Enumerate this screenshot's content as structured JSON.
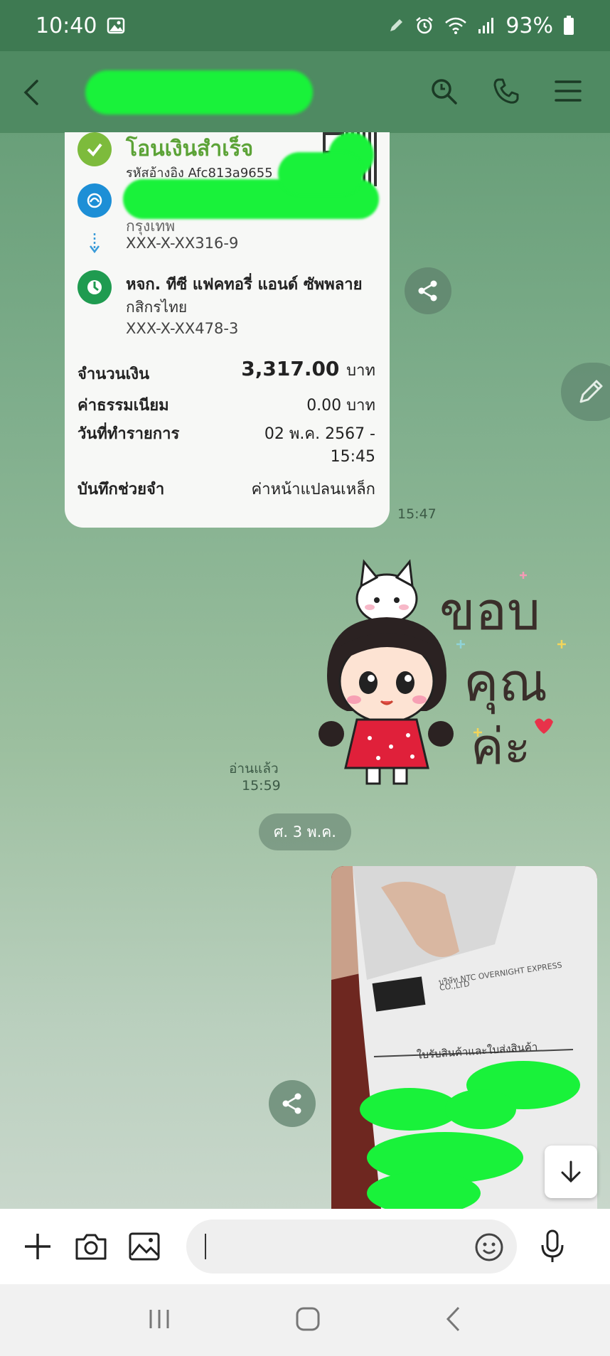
{
  "status_bar": {
    "time": "10:40",
    "battery": "93%",
    "icons": [
      "gallery-icon",
      "pen-icon",
      "alarm-icon",
      "wifi-icon",
      "signal-icon",
      "battery-icon"
    ]
  },
  "header": {
    "icons": [
      "back-icon",
      "search-icon",
      "phone-icon",
      "menu-icon"
    ]
  },
  "receipt": {
    "title": "โอนเงินสำเร็จ",
    "reference": "รหัสอ้างอิง Afc813a9655",
    "sender_account": "XXX-X-XX316-9",
    "sender_bank_partial": "กรุงเทพ",
    "recipient_name": "หจก. ทีซี แฟคทอรี่ แอนด์ ซัพพลาย",
    "recipient_bank": "กสิกรไทย",
    "recipient_account": "XXX-X-XX478-3",
    "amount_label": "จำนวนเงิน",
    "amount_value": "3,317.00",
    "currency": "บาท",
    "fee_label": "ค่าธรรมเนียม",
    "fee_value": "0.00",
    "date_label": "วันที่ทำรายการ",
    "date_value_line1": "02 พ.ค. 2567 -",
    "date_value_line2": "15:45",
    "memo_label": "บันทึกช่วยจำ",
    "memo_value": "ค่าหน้าแปลนเหล็ก"
  },
  "messages": {
    "receipt_time": "15:47",
    "read_label": "อ่านแล้ว",
    "sticker_time": "15:59",
    "sticker_text": [
      "ขอบ",
      "คุณ",
      "ค่ะ"
    ],
    "date_chip": "ศ. 3 พ.ค."
  },
  "photo": {
    "receipt_lines": [
      "บริษัท NTC OVERNIGHT EXPRESS",
      "CO.,LTD",
      "ใบรับสินค้าและใบส่งสินค้า"
    ]
  },
  "colors": {
    "accent_green": "#19f23a",
    "header_green": "#4f8a62",
    "status_green": "#3e7a52"
  }
}
